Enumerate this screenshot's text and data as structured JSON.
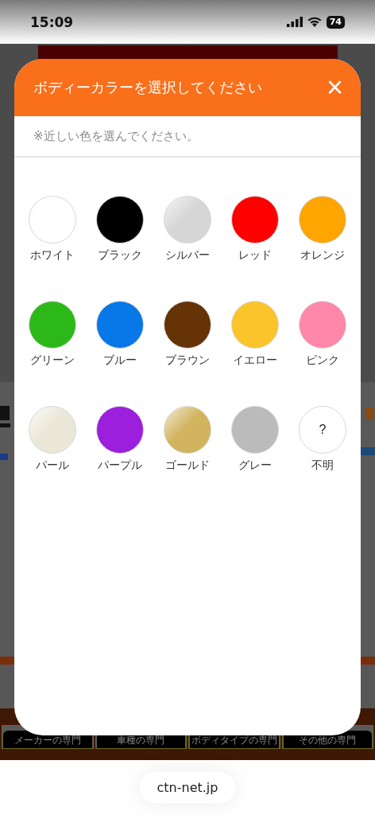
{
  "status_bar": {
    "time": "15:09",
    "battery": "74"
  },
  "background_page": {
    "buttons": [
      "メーカーの専門",
      "車種の専門",
      "ボディタイプの専門",
      "その他の専門"
    ]
  },
  "dialog": {
    "title": "ボディーカラーを選択してください",
    "close": "×",
    "note": "※近しい色を選んでください。",
    "colors": [
      {
        "label": "ホワイト",
        "color": "#ffffff",
        "kind": "solid"
      },
      {
        "label": "ブラック",
        "color": "#000000",
        "kind": "solid"
      },
      {
        "label": "シルバー",
        "color": "#d6d6d6",
        "kind": "metallic"
      },
      {
        "label": "レッド",
        "color": "#ff0000",
        "kind": "solid"
      },
      {
        "label": "オレンジ",
        "color": "#ffa500",
        "kind": "solid"
      },
      {
        "label": "グリーン",
        "color": "#2db81a",
        "kind": "solid"
      },
      {
        "label": "ブルー",
        "color": "#0877e8",
        "kind": "solid"
      },
      {
        "label": "ブラウン",
        "color": "#663307",
        "kind": "solid"
      },
      {
        "label": "イエロー",
        "color": "#fbc42a",
        "kind": "solid"
      },
      {
        "label": "ピンク",
        "color": "#ff88aa",
        "kind": "solid"
      },
      {
        "label": "パール",
        "color": "#ebe7d8",
        "kind": "metallic"
      },
      {
        "label": "パープル",
        "color": "#9b1fdc",
        "kind": "solid"
      },
      {
        "label": "ゴールド",
        "color": "#d2b35e",
        "kind": "metallic"
      },
      {
        "label": "グレー",
        "color": "#bbbbbb",
        "kind": "solid"
      },
      {
        "label": "不明",
        "color": "#ffffff",
        "kind": "unknown",
        "symbol": "?"
      }
    ]
  },
  "browser": {
    "url": "ctn-net.jp"
  }
}
